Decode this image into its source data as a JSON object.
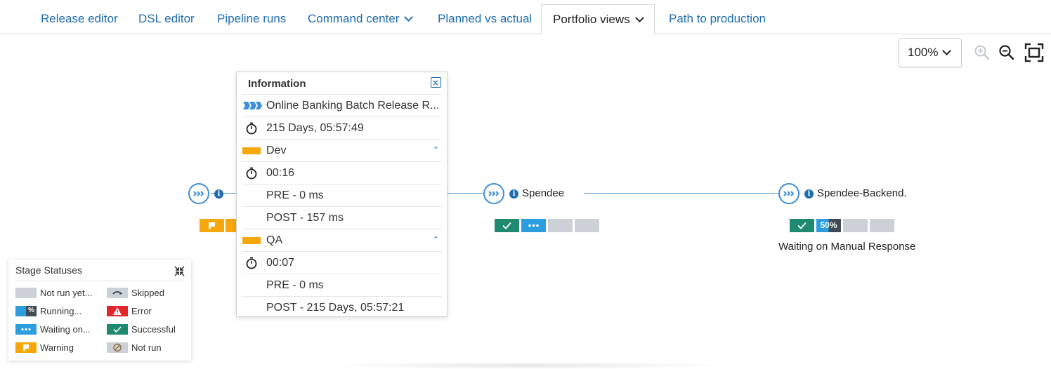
{
  "tabs": [
    {
      "label": "Release editor"
    },
    {
      "label": "DSL editor"
    },
    {
      "label": "Pipeline runs"
    },
    {
      "label": "Command center"
    },
    {
      "label": "Planned vs actual"
    },
    {
      "label": "Portfolio views"
    },
    {
      "label": "Path to production"
    }
  ],
  "toolbar": {
    "zoom_value": "100%"
  },
  "nodes": [
    {
      "label": "Spendee"
    },
    {
      "label": "Spendee-Backend."
    }
  ],
  "node_status": {
    "spendee_backend_progress": "50%",
    "spendee_backend_message": "Waiting on Manual Response"
  },
  "popup": {
    "title": "Information",
    "rows": [
      "Online Banking Batch Release R...",
      "215 Days, 05:57:49",
      "Dev",
      "00:16",
      "PRE - 0 ms",
      "POST - 157 ms",
      "QA",
      "00:07",
      "PRE - 0 ms",
      "POST - 215 Days, 05:57:21"
    ]
  },
  "legend": {
    "title": "Stage Statuses",
    "items": [
      {
        "label": "Not run yet..."
      },
      {
        "label": "Skipped"
      },
      {
        "label": "Running..."
      },
      {
        "label": "Error"
      },
      {
        "label": "Waiting on..."
      },
      {
        "label": "Successful"
      },
      {
        "label": "Warning"
      },
      {
        "label": "Not run"
      }
    ]
  },
  "colors": {
    "link": "#1f6cb0",
    "success": "#1f8a70",
    "waiting": "#2c9ee0",
    "warning": "#f5a70c",
    "error": "#e0262a",
    "not_run": "#cbd1d6"
  }
}
